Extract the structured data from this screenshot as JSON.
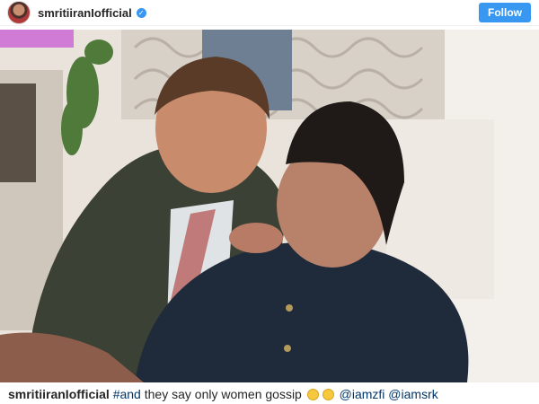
{
  "header": {
    "username": "smritiiranIofficial",
    "verified_icon": "verified-badge-icon",
    "follow_label": "Follow"
  },
  "photo": {
    "icon": "post-photo"
  },
  "caption": {
    "username": "smritiiranIofficial",
    "hashtag": "#and",
    "text": " they say only women gossip ",
    "emojis": [
      "hushed-face-icon",
      "wink-face-icon"
    ],
    "mention_1": "@iamzfi",
    "mention_2": "@iamsrk"
  },
  "colors": {
    "accent": "#3897f0",
    "link": "#003569",
    "text": "#262626"
  }
}
